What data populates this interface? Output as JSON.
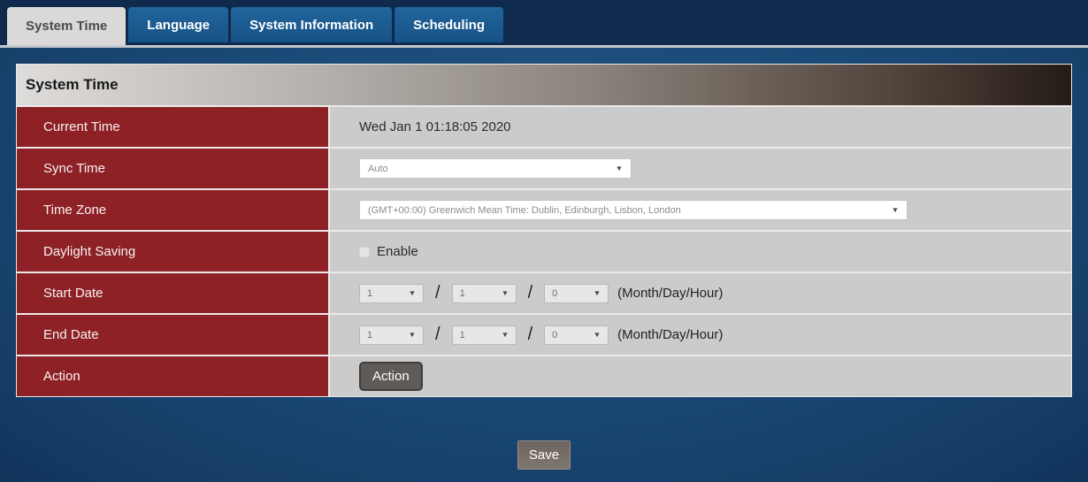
{
  "tabs": [
    {
      "label": "System Time",
      "active": true
    },
    {
      "label": "Language",
      "active": false
    },
    {
      "label": "System Information",
      "active": false
    },
    {
      "label": "Scheduling",
      "active": false
    }
  ],
  "panel": {
    "title": "System Time",
    "rows": {
      "current_time": {
        "label": "Current Time",
        "value": "Wed Jan 1 01:18:05 2020"
      },
      "sync_time": {
        "label": "Sync Time",
        "selected": "Auto"
      },
      "time_zone": {
        "label": "Time Zone",
        "selected": "(GMT+00:00) Greenwich Mean Time: Dublin, Edinburgh, Lisbon, London"
      },
      "daylight_saving": {
        "label": "Daylight Saving",
        "checkbox_label": "Enable",
        "checked": false
      },
      "start_date": {
        "label": "Start Date",
        "month": "1",
        "day": "1",
        "hour": "0",
        "separator": "/",
        "suffix": "(Month/Day/Hour)"
      },
      "end_date": {
        "label": "End Date",
        "month": "1",
        "day": "1",
        "hour": "0",
        "separator": "/",
        "suffix": "(Month/Day/Hour)"
      },
      "action": {
        "label": "Action",
        "button_label": "Action"
      }
    }
  },
  "buttons": {
    "save": "Save"
  },
  "icons": {
    "dropdown_arrow": "▼"
  },
  "colors": {
    "accent_red": "#8e2126",
    "tab_blue": "#1d6095",
    "navy_bar": "#102a4d",
    "body_blue": "#1b4a77",
    "content_gray": "#cbcbcb",
    "header_gradient_start": "#dedcda",
    "header_gradient_end": "#241b15"
  }
}
